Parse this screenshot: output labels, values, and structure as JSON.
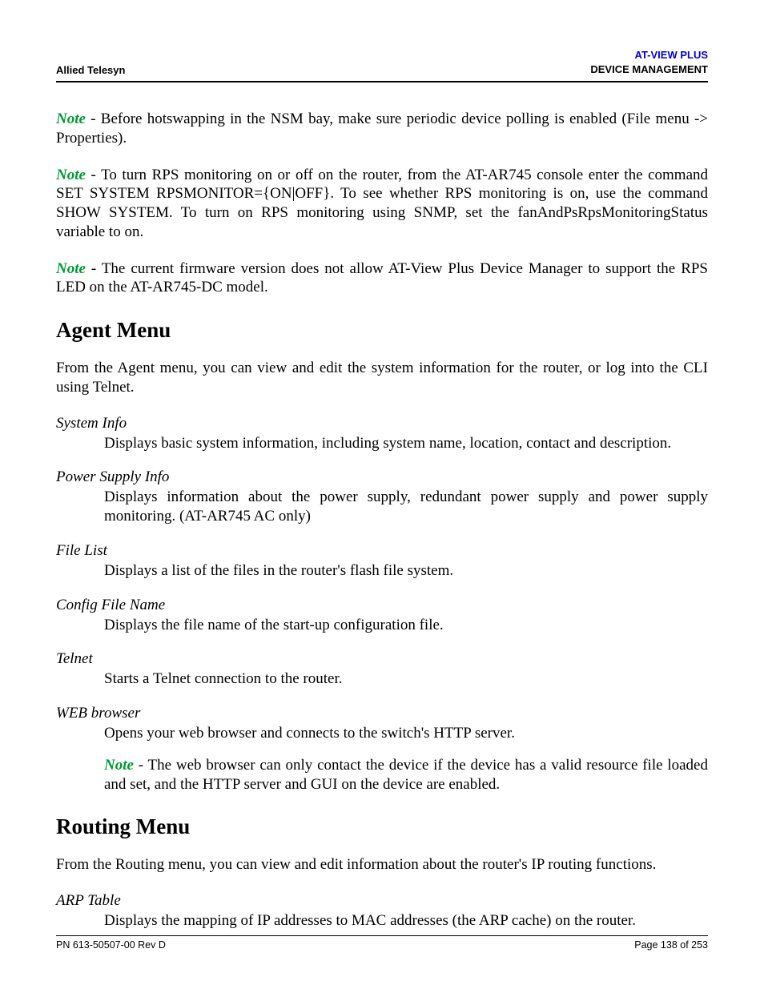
{
  "header": {
    "left": "Allied Telesyn",
    "right_top": "AT-VIEW PLUS",
    "right_bottom": "DEVICE MANAGEMENT"
  },
  "notes": {
    "label": "Note",
    "n1": " - Before hotswapping in the NSM bay, make sure periodic device polling is enabled (File menu -> Properties).",
    "n2": " - To turn RPS monitoring on or off on the router, from the AT-AR745 console enter the command SET SYSTEM RPSMONITOR={ON|OFF}. To see whether RPS monitoring is on, use the command SHOW SYSTEM. To turn on RPS monitoring using SNMP, set the fanAndPsRpsMonitoringStatus variable to on.",
    "n3": " - The current firmware version does not allow AT-View Plus Device Manager to support the RPS LED on the AT-AR745-DC model."
  },
  "agent": {
    "heading": "Agent Menu",
    "intro": "From the Agent menu, you can view and edit the system information for the router, or log into the CLI using Telnet.",
    "items": [
      {
        "term": "System Info",
        "def": "Displays basic system information, including system name, location, contact and description."
      },
      {
        "term": "Power Supply Info",
        "def": "Displays information about the power supply, redundant power supply and power supply monitoring. (AT-AR745 AC only)"
      },
      {
        "term": "File List",
        "def": "Displays a list of the files in the router's flash file system."
      },
      {
        "term": "Config File Name",
        "def": "Displays the file name of the start-up configuration file."
      },
      {
        "term": "Telnet",
        "def": "Starts a Telnet connection to the router."
      },
      {
        "term": "WEB browser",
        "def": "Opens your web browser and connects to the switch's HTTP server.",
        "note": " - The web browser can only contact the device if the device has a valid resource file loaded and set, and the HTTP server and GUI on the device are enabled."
      }
    ]
  },
  "routing": {
    "heading": "Routing Menu",
    "intro": "From the Routing menu, you can view and edit information about the router's IP routing functions.",
    "items": [
      {
        "term": "ARP Table",
        "def": "Displays the mapping of IP addresses to MAC addresses (the ARP cache) on the router."
      }
    ]
  },
  "footer": {
    "left": "PN 613-50507-00 Rev D",
    "right": "Page 138 of 253"
  }
}
